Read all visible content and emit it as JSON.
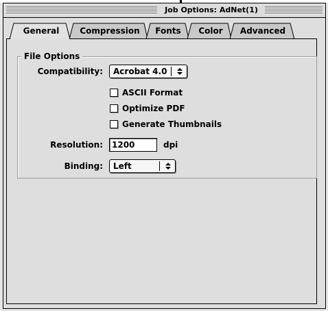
{
  "window": {
    "title": "Job Options: AdNet(1)"
  },
  "tabs": [
    {
      "label": "General",
      "active": true
    },
    {
      "label": "Compression",
      "active": false
    },
    {
      "label": "Fonts",
      "active": false
    },
    {
      "label": "Color",
      "active": false
    },
    {
      "label": "Advanced",
      "active": false
    }
  ],
  "file_options": {
    "legend": "File Options",
    "compatibility": {
      "label": "Compatibility:",
      "value": "Acrobat 4.0",
      "arrows": "▲▼"
    },
    "checkboxes": [
      {
        "label": "ASCII Format",
        "checked": false
      },
      {
        "label": "Optimize PDF",
        "checked": false
      },
      {
        "label": "Generate Thumbnails",
        "checked": false
      }
    ],
    "resolution": {
      "label": "Resolution:",
      "value": "1200",
      "unit": "dpi"
    },
    "binding": {
      "label": "Binding:",
      "value": "Left",
      "arrows": "▲▼"
    }
  }
}
